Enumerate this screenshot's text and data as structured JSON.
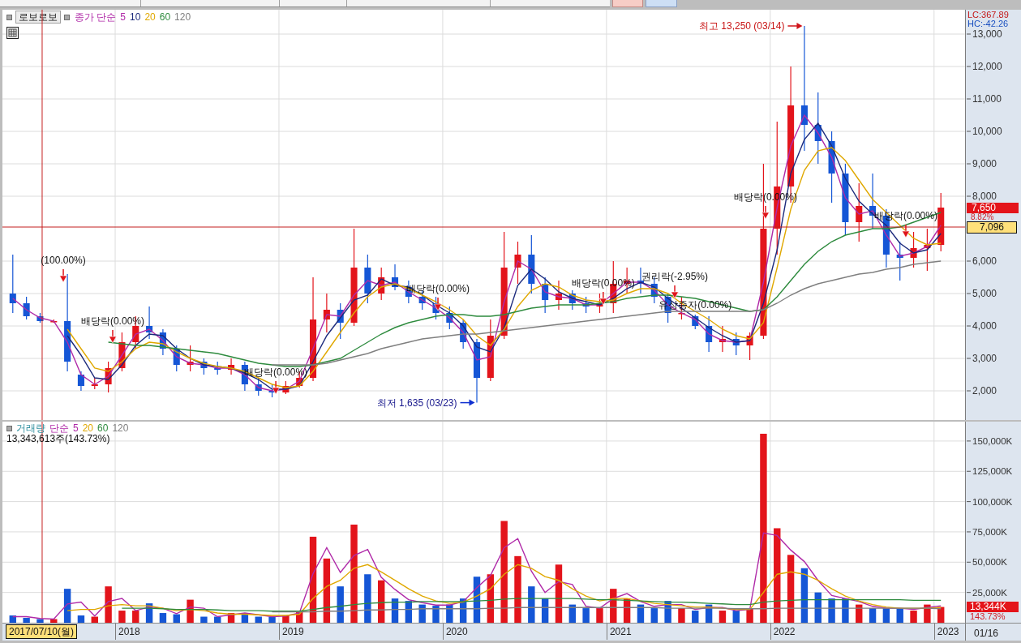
{
  "price_panel": {
    "stock_name": "로보로보",
    "legend_prefix": "종가 단순",
    "axis": {
      "lc": "LC:367.89",
      "hc": "HC:-42.26",
      "current_price": "7,650",
      "change": "8.82%",
      "cursor_price": "7,096"
    },
    "markers": [
      {
        "kind": "event",
        "text": "(100.00%)"
      },
      {
        "kind": "event",
        "text": "배당락(0.00%)"
      },
      {
        "kind": "event",
        "text": "배당락(0.00%)"
      },
      {
        "kind": "event",
        "text": "배당락(0.00%)"
      },
      {
        "kind": "event",
        "text": "배당락(0.00%)"
      },
      {
        "kind": "event",
        "text": "권리락(-2.95%)"
      },
      {
        "kind": "note",
        "text": "유상증자(0.00%)"
      },
      {
        "kind": "event",
        "text": "배당락(0.00%)"
      },
      {
        "kind": "event",
        "text": "배당락(0.00%)"
      },
      {
        "kind": "high",
        "text": "최고 13,250 (03/14)"
      },
      {
        "kind": "low",
        "text": "최저 1,635 (03/23)"
      }
    ],
    "chart_data": {
      "type": "candlestick",
      "ylim": [
        1100,
        13750
      ],
      "grid": true,
      "yticks": [
        {
          "value": 2000,
          "label": "2,000"
        },
        {
          "value": 3000,
          "label": "3,000"
        },
        {
          "value": 4000,
          "label": "4,000"
        },
        {
          "value": 5000,
          "label": "5,000"
        },
        {
          "value": 6000,
          "label": "6,000"
        },
        {
          "value": 8000,
          "label": "8,000"
        },
        {
          "value": 9000,
          "label": "9,000"
        },
        {
          "value": 10000,
          "label": "10,000"
        },
        {
          "value": 11000,
          "label": "11,000"
        },
        {
          "value": 12000,
          "label": "12,000"
        },
        {
          "value": 13000,
          "label": "13,000"
        }
      ],
      "ohlc": [
        [
          5000,
          6200,
          4400,
          4700
        ],
        [
          4700,
          4900,
          4200,
          4300
        ],
        [
          4300,
          4400,
          4100,
          4150
        ],
        [
          4150,
          4200,
          4100,
          4150
        ],
        [
          4150,
          5600,
          2600,
          2900
        ],
        [
          2500,
          2600,
          2000,
          2150
        ],
        [
          2150,
          2400,
          2050,
          2200
        ],
        [
          2200,
          2900,
          1950,
          2700
        ],
        [
          2700,
          3800,
          2600,
          3500
        ],
        [
          3500,
          4300,
          3300,
          4000
        ],
        [
          4000,
          4600,
          3600,
          3800
        ],
        [
          3800,
          3900,
          3100,
          3300
        ],
        [
          3300,
          3400,
          2600,
          2800
        ],
        [
          2800,
          3400,
          2600,
          2900
        ],
        [
          2900,
          3000,
          2500,
          2700
        ],
        [
          2700,
          2900,
          2500,
          2650
        ],
        [
          2650,
          3000,
          2500,
          2800
        ],
        [
          2800,
          2900,
          2000,
          2200
        ],
        [
          2200,
          2400,
          1850,
          2000
        ],
        [
          2000,
          2200,
          1800,
          1950
        ],
        [
          1950,
          2300,
          1900,
          2150
        ],
        [
          2150,
          2600,
          2100,
          2400
        ],
        [
          2400,
          5500,
          2300,
          4200
        ],
        [
          4200,
          5000,
          3800,
          4500
        ],
        [
          4500,
          4700,
          3600,
          4100
        ],
        [
          4100,
          7000,
          4000,
          5800
        ],
        [
          5800,
          6200,
          4700,
          5000
        ],
        [
          5000,
          5800,
          4800,
          5500
        ],
        [
          5500,
          5900,
          5100,
          5200
        ],
        [
          5200,
          5400,
          4700,
          4900
        ],
        [
          4900,
          5100,
          4500,
          4700
        ],
        [
          4700,
          4900,
          4200,
          4400
        ],
        [
          4400,
          4600,
          3900,
          4100
        ],
        [
          4100,
          4200,
          3300,
          3500
        ],
        [
          3500,
          3600,
          1635,
          2400
        ],
        [
          2400,
          4200,
          2300,
          3700
        ],
        [
          3700,
          6900,
          3600,
          5800
        ],
        [
          5800,
          6600,
          5300,
          6200
        ],
        [
          6200,
          6800,
          5000,
          5300
        ],
        [
          5300,
          5500,
          4400,
          4800
        ],
        [
          4800,
          5400,
          4500,
          5000
        ],
        [
          5000,
          5100,
          4500,
          4700
        ],
        [
          4700,
          4900,
          4400,
          4600
        ],
        [
          4600,
          5000,
          4400,
          4700
        ],
        [
          4700,
          6000,
          4400,
          5300
        ],
        [
          5300,
          5800,
          5000,
          5400
        ],
        [
          5400,
          5800,
          5000,
          5300
        ],
        [
          5300,
          5500,
          4700,
          4900
        ],
        [
          4900,
          5000,
          4100,
          4400
        ],
        [
          4400,
          4900,
          4200,
          4400
        ],
        [
          4300,
          4350,
          3900,
          4000
        ],
        [
          4000,
          4300,
          3200,
          3500
        ],
        [
          3500,
          4000,
          3200,
          3600
        ],
        [
          3600,
          3800,
          3100,
          3400
        ],
        [
          3400,
          3800,
          2950,
          3700
        ],
        [
          3700,
          9000,
          3600,
          7000
        ],
        [
          7000,
          10300,
          6200,
          8300
        ],
        [
          8300,
          12000,
          7800,
          10800
        ],
        [
          10800,
          13250,
          9400,
          10200
        ],
        [
          10200,
          11200,
          9000,
          9700
        ],
        [
          9700,
          10000,
          7800,
          8700
        ],
        [
          8700,
          9000,
          6800,
          7200
        ],
        [
          7200,
          8400,
          6600,
          7700
        ],
        [
          7700,
          8700,
          7000,
          7400
        ],
        [
          7400,
          7600,
          5800,
          6200
        ],
        [
          6200,
          6600,
          5400,
          6100
        ],
        [
          6100,
          6900,
          5800,
          6400
        ],
        [
          6400,
          7000,
          5700,
          6500
        ],
        [
          6500,
          8100,
          6300,
          7650
        ]
      ],
      "series": [
        {
          "name": "5",
          "type": "line",
          "color": "#b02aa8",
          "values": [
            4850,
            4500,
            4250,
            4150,
            3500,
            2500,
            2200,
            2450,
            3100,
            3750,
            3900,
            3550,
            3050,
            2850,
            2800,
            2700,
            2700,
            2500,
            2100,
            2000,
            2050,
            2300,
            3300,
            4350,
            4300,
            4950,
            5400,
            5250,
            5350,
            5050,
            4800,
            4550,
            4250,
            3800,
            2950,
            3050,
            4750,
            6000,
            5750,
            5050,
            4900,
            4850,
            4650,
            4650,
            5000,
            5350,
            5350,
            5100,
            4650,
            4400,
            4200,
            3750,
            3550,
            3500,
            3550,
            5350,
            7650,
            9550,
            10500,
            9950,
            9200,
            7950,
            7450,
            7550,
            6800,
            6150,
            6250,
            6450,
            7100
          ]
        },
        {
          "name": "10",
          "type": "line",
          "color": "#1c2a7c",
          "values": [
            null,
            null,
            null,
            null,
            3700,
            3100,
            2400,
            2350,
            2800,
            3400,
            3750,
            3700,
            3300,
            3000,
            2800,
            2750,
            2700,
            2550,
            2350,
            2050,
            2050,
            2150,
            2900,
            3700,
            4250,
            4800,
            4950,
            5450,
            5250,
            5200,
            4950,
            4650,
            4400,
            4000,
            3350,
            3200,
            3950,
            5250,
            5750,
            5450,
            5050,
            4850,
            4750,
            4650,
            4850,
            5150,
            5350,
            5200,
            4850,
            4550,
            4250,
            3950,
            3700,
            3500,
            3550,
            4700,
            6350,
            8700,
            9750,
            10250,
            9550,
            8550,
            7850,
            7450,
            7100,
            6550,
            6250,
            6350,
            6850
          ]
        },
        {
          "name": "20",
          "type": "line",
          "color": "#e0a800",
          "values": [
            null,
            null,
            null,
            null,
            3900,
            3300,
            2700,
            2600,
            2900,
            3300,
            3500,
            3450,
            3200,
            3000,
            2850,
            2750,
            2700,
            2600,
            2400,
            2200,
            2100,
            2150,
            2600,
            3200,
            3800,
            4400,
            4900,
            5200,
            5300,
            5150,
            4950,
            4750,
            4500,
            4200,
            3700,
            3400,
            3900,
            4600,
            5100,
            5300,
            5200,
            4950,
            4800,
            4750,
            4800,
            5000,
            5150,
            5150,
            5000,
            4700,
            4450,
            4200,
            3900,
            3700,
            3600,
            4100,
            5800,
            7600,
            8800,
            9400,
            9500,
            9100,
            8500,
            7900,
            7500,
            7100,
            6700,
            6500,
            6550
          ]
        },
        {
          "name": "60",
          "type": "line",
          "color": "#2e8b3e",
          "values": [
            null,
            null,
            null,
            null,
            null,
            null,
            null,
            3500,
            3450,
            3400,
            3400,
            3350,
            3300,
            3250,
            3200,
            3150,
            3050,
            2950,
            2850,
            2800,
            2750,
            2750,
            2800,
            2900,
            3000,
            3250,
            3500,
            3750,
            3950,
            4100,
            4200,
            4300,
            4350,
            4350,
            4300,
            4300,
            4350,
            4450,
            4550,
            4600,
            4650,
            4650,
            4650,
            4700,
            4750,
            4850,
            4900,
            4950,
            4950,
            4900,
            4850,
            4750,
            4650,
            4550,
            4450,
            4500,
            4900,
            5400,
            5900,
            6300,
            6600,
            6800,
            6900,
            7000,
            7000,
            7050,
            7200,
            7350,
            7500
          ]
        },
        {
          "name": "120",
          "type": "line",
          "color": "#7f7f7f",
          "values": [
            null,
            null,
            null,
            null,
            null,
            null,
            null,
            null,
            null,
            null,
            null,
            null,
            null,
            null,
            null,
            null,
            null,
            null,
            null,
            2800,
            2800,
            2800,
            2800,
            2850,
            2950,
            3050,
            3150,
            3300,
            3400,
            3500,
            3600,
            3650,
            3700,
            3750,
            3750,
            3800,
            3850,
            3900,
            3950,
            4000,
            4050,
            4100,
            4150,
            4200,
            4250,
            4300,
            4350,
            4400,
            4450,
            4450,
            4450,
            4450,
            4450,
            4450,
            4450,
            4500,
            4700,
            4950,
            5150,
            5300,
            5400,
            5500,
            5600,
            5650,
            5750,
            5800,
            5900,
            5950,
            6000
          ]
        }
      ]
    }
  },
  "volume_panel": {
    "legend_prefix": "단순",
    "info": "13,343,613주(143.73%)",
    "axis": {
      "current_volume": "13,344K",
      "ratio": "143.73%"
    },
    "chart_data": {
      "type": "bar",
      "ylim": [
        0,
        166000
      ],
      "grid": true,
      "yticks": [
        {
          "value": 25000,
          "label": "25,000K"
        },
        {
          "value": 50000,
          "label": "50,000K"
        },
        {
          "value": 75000,
          "label": "75,000K"
        },
        {
          "value": 100000,
          "label": "100,000K"
        },
        {
          "value": 125000,
          "label": "125,000K"
        },
        {
          "value": 150000,
          "label": "150,000K"
        }
      ],
      "series": [
        {
          "name": "거래량",
          "values": [
            6000,
            4000,
            3000,
            3000,
            28000,
            6000,
            5000,
            30000,
            10000,
            10000,
            16000,
            8000,
            7000,
            19000,
            5000,
            5000,
            8000,
            8000,
            5000,
            5000,
            6000,
            10000,
            71000,
            53000,
            30000,
            81000,
            40000,
            35000,
            20000,
            18000,
            15000,
            14000,
            15000,
            20000,
            38000,
            40000,
            84000,
            55000,
            30000,
            20000,
            48000,
            15000,
            12000,
            12000,
            28000,
            20000,
            15000,
            12000,
            18000,
            12000,
            10000,
            15000,
            10000,
            10000,
            12000,
            156000,
            78000,
            56000,
            45000,
            25000,
            20000,
            20000,
            15000,
            12000,
            12000,
            12000,
            10000,
            15000,
            13000
          ],
          "colors": [
            "#1556d6",
            "#1556d6",
            "#1556d6",
            "#e3141b",
            "#1556d6",
            "#1556d6",
            "#e3141b",
            "#e3141b",
            "#e3141b",
            "#e3141b",
            "#1556d6",
            "#1556d6",
            "#1556d6",
            "#e3141b",
            "#1556d6",
            "#1556d6",
            "#e3141b",
            "#1556d6",
            "#1556d6",
            "#1556d6",
            "#e3141b",
            "#e3141b",
            "#e3141b",
            "#e3141b",
            "#1556d6",
            "#e3141b",
            "#1556d6",
            "#e3141b",
            "#1556d6",
            "#1556d6",
            "#1556d6",
            "#1556d6",
            "#1556d6",
            "#1556d6",
            "#1556d6",
            "#e3141b",
            "#e3141b",
            "#e3141b",
            "#1556d6",
            "#1556d6",
            "#e3141b",
            "#1556d6",
            "#1556d6",
            "#e3141b",
            "#e3141b",
            "#e3141b",
            "#1556d6",
            "#1556d6",
            "#1556d6",
            "#e3141b",
            "#1556d6",
            "#1556d6",
            "#e3141b",
            "#1556d6",
            "#e3141b",
            "#e3141b",
            "#e3141b",
            "#e3141b",
            "#1556d6",
            "#1556d6",
            "#1556d6",
            "#1556d6",
            "#e3141b",
            "#1556d6",
            "#1556d6",
            "#1556d6",
            "#e3141b",
            "#e3141b",
            "#e3141b"
          ]
        },
        {
          "name": "5",
          "type": "line",
          "color": "#b02aa8",
          "values": [
            5000,
            5000,
            3500,
            3000,
            15500,
            17000,
            5500,
            17500,
            20000,
            10000,
            13000,
            12000,
            7500,
            13000,
            12000,
            5000,
            6500,
            8000,
            6500,
            5000,
            5500,
            8000,
            40500,
            62000,
            41500,
            55500,
            60500,
            37500,
            27500,
            19000,
            16500,
            14500,
            14500,
            17500,
            29000,
            39000,
            62000,
            69500,
            42500,
            25000,
            34000,
            31500,
            13500,
            12000,
            20000,
            24000,
            17500,
            13500,
            15000,
            15000,
            11000,
            12500,
            12500,
            10000,
            11000,
            74000,
            72000,
            60000,
            50500,
            35000,
            22500,
            20000,
            17500,
            13500,
            12000,
            12000,
            11000,
            12500,
            14000
          ]
        },
        {
          "name": "20",
          "type": "line",
          "color": "#e0a800",
          "values": [
            null,
            null,
            null,
            null,
            10000,
            11000,
            11000,
            14000,
            15000,
            14000,
            14000,
            12000,
            10000,
            11000,
            10000,
            8000,
            7000,
            7000,
            6500,
            6000,
            6000,
            7000,
            20000,
            30000,
            35000,
            45000,
            48000,
            42000,
            35000,
            28000,
            22000,
            18000,
            16000,
            17000,
            22000,
            28000,
            40000,
            48000,
            45000,
            38000,
            35000,
            28000,
            22000,
            18000,
            20000,
            20000,
            18000,
            16000,
            15000,
            14000,
            13000,
            13000,
            12000,
            11000,
            11000,
            25000,
            40000,
            42000,
            40000,
            35000,
            28000,
            22000,
            18000,
            15000,
            13000,
            12000,
            12000,
            12000,
            12500
          ]
        },
        {
          "name": "60",
          "type": "line",
          "color": "#2e8b3e",
          "values": [
            null,
            null,
            null,
            null,
            null,
            null,
            null,
            null,
            12000,
            12000,
            12000,
            11500,
            11000,
            11000,
            11000,
            10500,
            10000,
            10000,
            10000,
            9500,
            9500,
            9500,
            11000,
            12500,
            13500,
            15000,
            16000,
            16500,
            17000,
            17000,
            17500,
            17500,
            17500,
            17500,
            18000,
            18500,
            19500,
            20000,
            20000,
            20000,
            20000,
            20000,
            19500,
            19000,
            19000,
            18500,
            18000,
            17500,
            17000,
            17000,
            16500,
            16000,
            15500,
            15000,
            15000,
            17000,
            18000,
            18500,
            19000,
            19000,
            19000,
            19000,
            19000,
            19000,
            19000,
            19000,
            18500,
            18500,
            18500
          ]
        },
        {
          "name": "120",
          "type": "line",
          "color": "#7f7f7f",
          "values": [
            null,
            null,
            null,
            null,
            null,
            null,
            null,
            null,
            null,
            null,
            null,
            null,
            null,
            null,
            null,
            null,
            null,
            null,
            null,
            9000,
            9000,
            9000,
            9000,
            9500,
            9500,
            10000,
            10500,
            10500,
            11000,
            11000,
            11500,
            11500,
            11500,
            11500,
            11500,
            12000,
            12000,
            12500,
            12500,
            12500,
            12500,
            12500,
            12500,
            12500,
            12500,
            12500,
            12500,
            12500,
            12000,
            12000,
            12000,
            12000,
            12000,
            11500,
            11500,
            11500,
            12000,
            12000,
            12000,
            12000,
            12000,
            12000,
            12000,
            12000,
            12000,
            12000,
            12000,
            12000,
            11500
          ]
        }
      ]
    }
  },
  "x_axis": {
    "labels": [
      "2018",
      "2019",
      "2020",
      "2021",
      "2022",
      "2023"
    ],
    "cursor_label": "2017/07/10(월)",
    "last_date": "01/16"
  }
}
